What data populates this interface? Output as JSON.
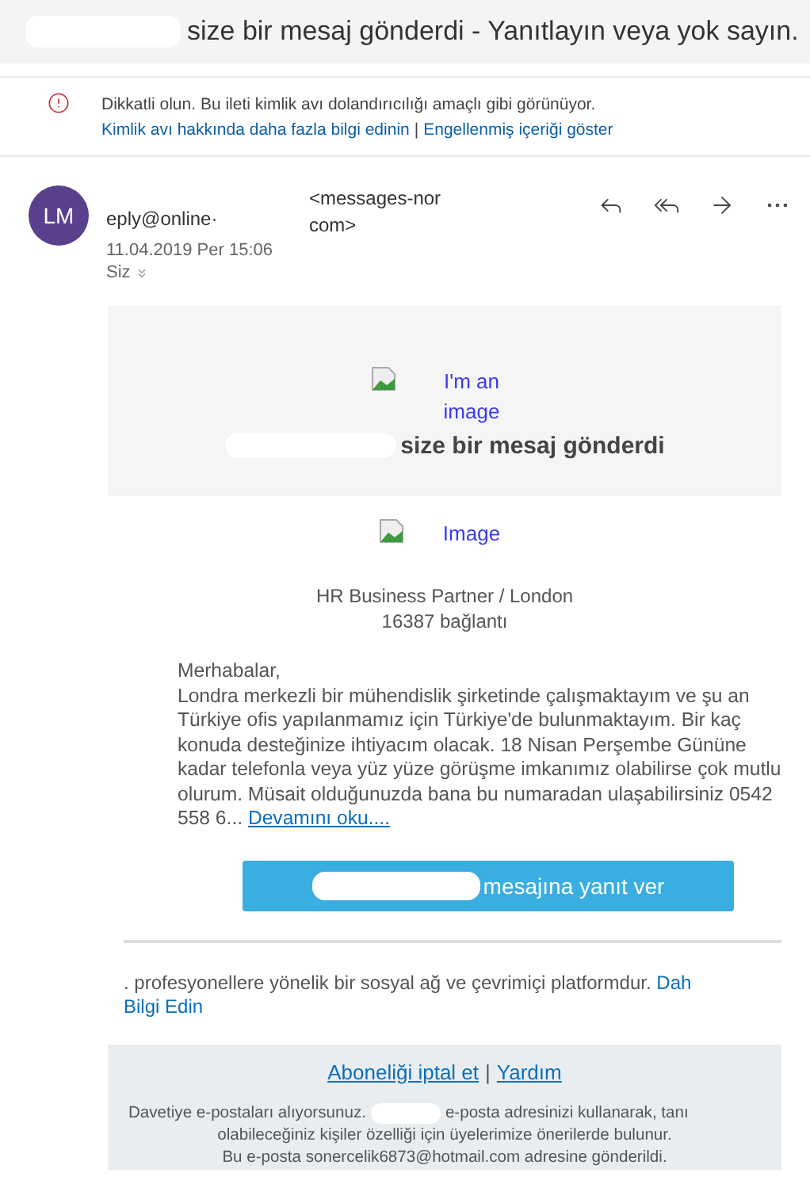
{
  "subject": "size bir mesaj gönderdi - Yanıtlayın veya yok sayın.",
  "warning": {
    "message": "Dikkatli olun. Bu ileti kimlik avı dolandırıcılığı amaçlı gibi görünüyor.",
    "links": [
      "Kimlik avı hakkında daha fazla bilgi edinin",
      "Engellenmiş içeriği göster"
    ],
    "separator": "|"
  },
  "sender": {
    "initials": "LM",
    "address_start": "eply@online·",
    "address_tag": [
      "<messages-nor",
      "com>"
    ],
    "date": "11.04.2019 Per 15:06",
    "recipient": "Siz"
  },
  "actions": [
    {
      "kind": "reply"
    },
    {
      "kind": "reply_all"
    },
    {
      "kind": "forward"
    },
    {
      "kind": "more"
    }
  ],
  "banner": {
    "image_alt": "I'm an image",
    "title": "size bir mesaj gönderdi"
  },
  "profile": {
    "image_alt": "Image",
    "headline": "HR Business Partner / London",
    "connections": "16387 bağlantı"
  },
  "message": {
    "greeting": "Merhabalar,",
    "body": "Londra merkezli bir mühendislik şirketinde çalışmaktayım ve şu an Türkiye ofis yapılanmamız için Türkiye'de bulunmaktayım. Bir kaç konuda desteğinize ihtiyacım olacak. 18 Nisan Perşembe Gününe kadar telefonla veya yüz yüze görüşme imkanımız olabilirse çok mutlu olurum. Müsait olduğunuzda bana bu numaradan ulaşabilirsiniz 0542 558 6...",
    "read_more": "Devamını oku...."
  },
  "reply_button": "mesajına yanıt ver",
  "about": {
    "text": ". profesyonellere yönelik bir sosyal ağ ve çevrimiçi platformdur.",
    "link_start": "Dah",
    "link_end": "Bilgi Edin"
  },
  "footer": {
    "links": [
      "Aboneliği iptal et",
      "Yardım"
    ],
    "separator": "|",
    "notice_start": "Davetiye e-postaları alıyorsunuz.",
    "notice_rest": "e-posta adresinizi kullanarak, tanı",
    "notice_line2": "olabileceğiniz kişiler özelliği için üyelerimize önerilerde bulunur.",
    "notice_line3": "Bu e-posta sonercelik6873@hotmail.com adresine gönderildi."
  }
}
